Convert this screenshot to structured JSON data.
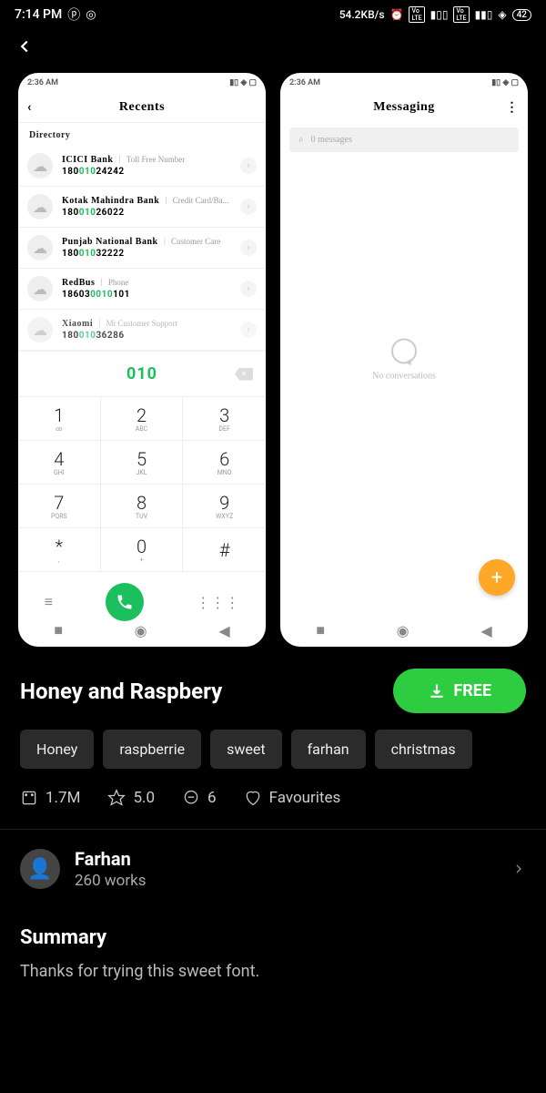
{
  "status": {
    "time": "7:14 PM",
    "speed": "54.2KB/s",
    "battery": "42"
  },
  "mini_time": "2:36 AM",
  "dialer": {
    "title": "Recents",
    "section": "Directory",
    "dialed": "010",
    "items": [
      {
        "name": "ICICI Bank",
        "sub": "Toll Free Number",
        "num_pre": "180",
        "num_g": "010",
        "num_post": "24242"
      },
      {
        "name": "Kotak Mahindra Bank",
        "sub": "Credit Card/Ba...",
        "num_pre": "180",
        "num_g": "010",
        "num_post": "26022"
      },
      {
        "name": "Punjab National Bank",
        "sub": "Customer Care",
        "num_pre": "180",
        "num_g": "010",
        "num_post": "32222"
      },
      {
        "name": "RedBus",
        "sub": "Phone",
        "num_pre": "18603",
        "num_g": "0010",
        "num_post": "101"
      },
      {
        "name": "Xiaomi",
        "sub": "Mi Customer Support",
        "num_pre": "180",
        "num_g": "010",
        "num_post": "36286"
      }
    ],
    "keys": [
      {
        "n": "1",
        "s": "∞"
      },
      {
        "n": "2",
        "s": "ABC"
      },
      {
        "n": "3",
        "s": "DEF"
      },
      {
        "n": "4",
        "s": "GHI"
      },
      {
        "n": "5",
        "s": "JKL"
      },
      {
        "n": "6",
        "s": "MNO"
      },
      {
        "n": "7",
        "s": "PQRS"
      },
      {
        "n": "8",
        "s": "TUV"
      },
      {
        "n": "9",
        "s": "WXYZ"
      },
      {
        "n": "*",
        "s": ","
      },
      {
        "n": "0",
        "s": "+"
      },
      {
        "n": "#",
        "s": ""
      }
    ]
  },
  "messaging": {
    "title": "Messaging",
    "search": "0 messages",
    "empty": "No conversations"
  },
  "theme": {
    "title": "Honey and Raspbery",
    "button": "FREE"
  },
  "tags": [
    "Honey",
    "raspberrie",
    "sweet",
    "farhan",
    "christmas"
  ],
  "stats": {
    "downloads": "1.7M",
    "rating": "5.0",
    "comments": "6",
    "fav": "Favourites"
  },
  "author": {
    "name": "Farhan",
    "works": "260 works"
  },
  "summary": {
    "title": "Summary",
    "text": "Thanks for trying this sweet font."
  }
}
